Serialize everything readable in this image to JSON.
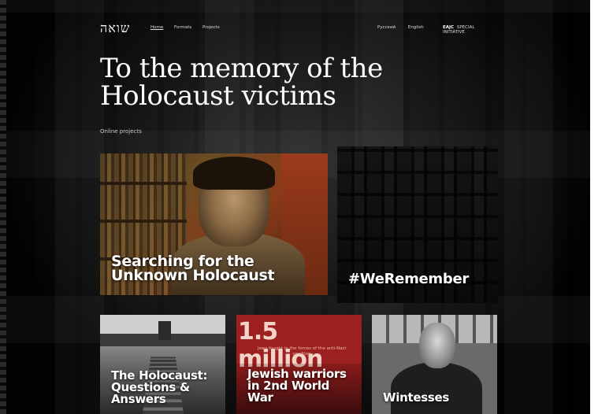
{
  "header": {
    "logo": "שואה",
    "nav": [
      "Home",
      "Formats",
      "Projects"
    ],
    "languages": [
      "Русский",
      "English"
    ],
    "initiative_brand": "EAJC",
    "initiative_text": "SPECIAL INITIATIVE"
  },
  "hero": {
    "title_line1": "To the memory of the",
    "title_line2": "Holocaust victims",
    "subtitle": "Online projects"
  },
  "cards": [
    {
      "label_line1": "Searching for the",
      "label_line2": "Unknown Holocaust"
    },
    {
      "label": "#WeRemember"
    },
    {
      "label_line1": "The Holocaust:",
      "label_line2": "Questions &",
      "label_line3": "Answers"
    },
    {
      "image_big": "1.5 million",
      "image_small": "Jews fought in the forces of the anti-Nazi coalition",
      "label_line1": "Jewish warriors",
      "label_line2": "in 2nd World",
      "label_line3": "War"
    },
    {
      "label": "Wintesses"
    }
  ]
}
